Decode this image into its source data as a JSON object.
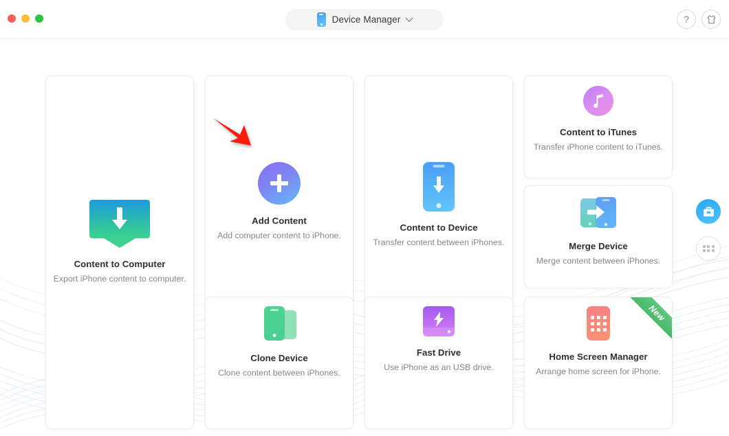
{
  "window": {
    "controls": [
      "close",
      "minimize",
      "maximize"
    ],
    "device_selector": {
      "label": "Device Manager",
      "icon": "phone-icon",
      "chevron": "chevron-down-icon"
    },
    "help_icon": "question-mark-icon",
    "help_label": "?",
    "theme_icon": "t-shirt-icon"
  },
  "rail": {
    "toolbox_icon": "toolbox-icon",
    "apps_grid_icon": "apps-grid-icon"
  },
  "annotation": {
    "arrow": "red-pointer-arrow",
    "color": "#f81f09",
    "points_to": "add-content"
  },
  "cards": [
    {
      "id": "content-to-computer",
      "title": "Content to Computer",
      "subtitle": "Export iPhone content to computer.",
      "icon": "monitor-download-icon",
      "badge": null
    },
    {
      "id": "add-content",
      "title": "Add Content",
      "subtitle": "Add computer content to iPhone.",
      "icon": "plus-circle-icon",
      "badge": null
    },
    {
      "id": "content-to-device",
      "title": "Content to Device",
      "subtitle": "Transfer content between iPhones.",
      "icon": "phone-download-icon",
      "badge": null
    },
    {
      "id": "content-to-itunes",
      "title": "Content to iTunes",
      "subtitle": "Transfer iPhone content to iTunes.",
      "icon": "music-note-icon",
      "badge": null
    },
    {
      "id": "merge-device",
      "title": "Merge Device",
      "subtitle": "Merge content between iPhones.",
      "icon": "two-phones-arrow-icon",
      "badge": null
    },
    {
      "id": "clone-device",
      "title": "Clone Device",
      "subtitle": "Clone content between iPhones.",
      "icon": "two-phones-icon",
      "badge": null
    },
    {
      "id": "fast-drive",
      "title": "Fast Drive",
      "subtitle": "Use iPhone as an USB drive.",
      "icon": "hard-drive-bolt-icon",
      "badge": null
    },
    {
      "id": "home-screen-manager",
      "title": "Home Screen Manager",
      "subtitle": "Arrange home screen for iPhone.",
      "icon": "phone-grid-icon",
      "badge": "New"
    }
  ],
  "colors": {
    "accent_blue": "#29a6f5",
    "badge_green": "#49b96a",
    "arrow_red": "#f81f09",
    "title_text": "#2f2f31",
    "sub_text": "#86868b",
    "card_border": "#ececec",
    "page_bg": "#ffffff"
  }
}
